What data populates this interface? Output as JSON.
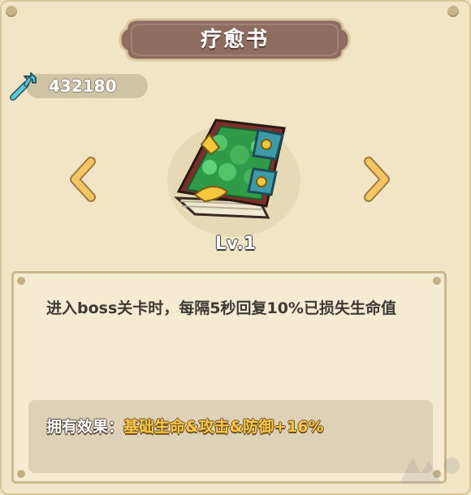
{
  "header": {
    "title": "疗愈书"
  },
  "currency": {
    "icon": "wrench-icon",
    "value": "432180"
  },
  "item": {
    "icon": "book-icon",
    "level": "Lv.1"
  },
  "navigation": {
    "prev_icon": "chevron-left-icon",
    "next_icon": "chevron-right-icon"
  },
  "panel": {
    "description": "进入boss关卡时，每隔5秒回复10%已损失生命值",
    "effect_label": "拥有效果：",
    "effect_value": "基础生命&攻击&防御+16%"
  },
  "colors": {
    "background": "#efe3c4",
    "title_plate": "#8c6d60",
    "accent_gold": "#f7c64b",
    "arrow": "#f5c563"
  }
}
